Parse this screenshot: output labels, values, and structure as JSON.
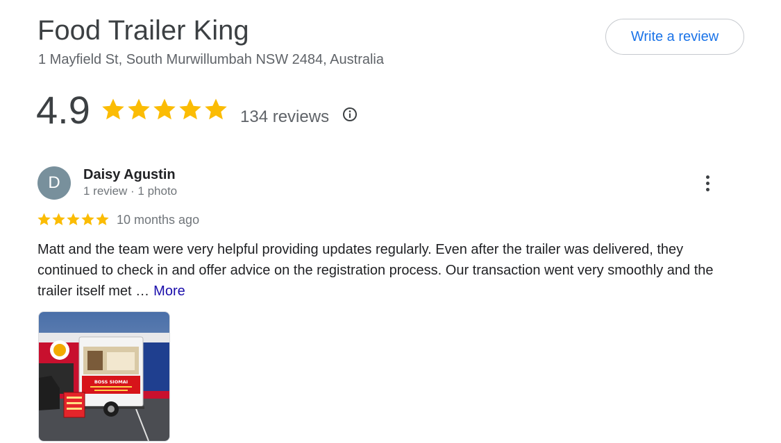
{
  "business": {
    "name": "Food Trailer King",
    "address": "1 Mayfield St, South Murwillumbah NSW 2484, Australia"
  },
  "actions": {
    "write_review_label": "Write a review"
  },
  "rating": {
    "value": "4.9",
    "stars": 5,
    "review_count_label": "134 reviews",
    "star_color": "#fbbc04"
  },
  "review": {
    "avatar_initial": "D",
    "avatar_color": "#78909c",
    "author": "Daisy Agustin",
    "author_meta": "1 review · 1 photo",
    "stars": 5,
    "date": "10 months ago",
    "text": "Matt and the team were very helpful providing updates regularly. Even after the trailer was delivered, they continued to check in and offer advice on the registration process. Our transaction went very smoothly and the trailer itself met …",
    "more_label": "More",
    "photo_sign_text": "BOSS SIOMAI"
  },
  "colors": {
    "link_blue": "#1a73e8",
    "more_link": "#1a0dab"
  }
}
